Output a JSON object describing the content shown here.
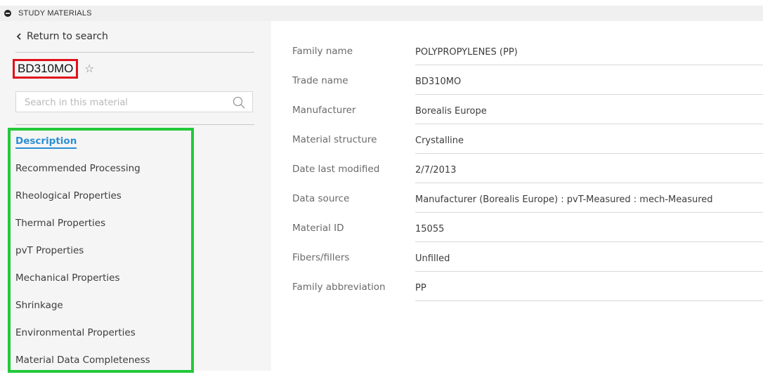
{
  "header": {
    "title": "STUDY MATERIALS",
    "collapse_icon": "minus-circle-icon"
  },
  "sidebar": {
    "back_label": "Return to search",
    "back_icon": "chevron-left-icon",
    "material_name": "BD310MO",
    "favorite_icon": "star-outline-icon",
    "search_placeholder": "Search in this material",
    "search_value": "",
    "search_icon": "search-icon",
    "nav_items": [
      {
        "label": "Description",
        "active": true
      },
      {
        "label": "Recommended Processing"
      },
      {
        "label": "Rheological Properties"
      },
      {
        "label": "Thermal Properties"
      },
      {
        "label": "pvT Properties"
      },
      {
        "label": "Mechanical Properties"
      },
      {
        "label": "Shrinkage"
      },
      {
        "label": "Environmental Properties"
      },
      {
        "label": "Material Data Completeness"
      }
    ]
  },
  "details": [
    {
      "label": "Family name",
      "value": "POLYPROPYLENES (PP)"
    },
    {
      "label": "Trade name",
      "value": "BD310MO"
    },
    {
      "label": "Manufacturer",
      "value": "Borealis Europe"
    },
    {
      "label": "Material structure",
      "value": "Crystalline"
    },
    {
      "label": "Date last modified",
      "value": "2/7/2013"
    },
    {
      "label": "Data source",
      "value": "Manufacturer (Borealis Europe)  : pvT-Measured : mech-Measured"
    },
    {
      "label": "Material ID",
      "value": "15055"
    },
    {
      "label": "Fibers/fillers",
      "value": "Unfilled"
    },
    {
      "label": "Family abbreviation",
      "value": "PP"
    }
  ],
  "colors": {
    "highlight_red": "#e0101a",
    "highlight_green": "#22c93a",
    "active_link": "#2a8fd4",
    "sidebar_bg": "#f5f5f5",
    "header_bg": "#f0f0f0"
  }
}
